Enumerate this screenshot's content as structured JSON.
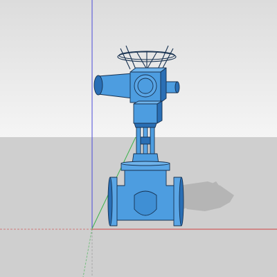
{
  "viewport": {
    "sky_top_color": "#dcdcdc",
    "sky_bottom_color": "#f5f5f5",
    "ground_color": "#cfcfcf",
    "axis_red_color": "#d04040",
    "axis_green_color": "#3ab24a",
    "axis_blue_color": "#4a4ad8",
    "axis_gray_color": "#a8a8a8"
  },
  "model": {
    "name_icon": "gate-valve-with-electric-actuator-icon",
    "body_color": "#4d9de0",
    "dark_color": "#2a6fb5",
    "outline_color": "#16304f",
    "shadow_color": "#b5b5b5"
  }
}
